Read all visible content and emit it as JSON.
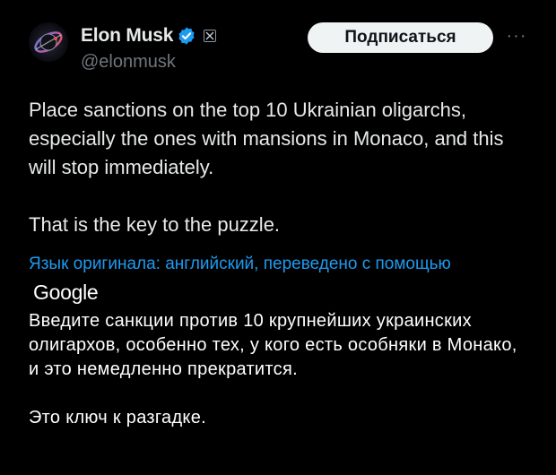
{
  "author": {
    "name": "Elon Musk",
    "handle": "@elonmusk",
    "verified_icon": "verified-badge-icon",
    "affiliation_icon": "x-logo-icon"
  },
  "actions": {
    "follow_label": "Подписаться",
    "more_label": "···"
  },
  "tweet": {
    "paragraph_1": "Place sanctions on the top 10 Ukrainian oligarchs, especially the ones with mansions in Monaco, and this will stop immediately.",
    "paragraph_2": "That is the key to the puzzle."
  },
  "translation": {
    "notice": "Язык оригинала: английский, переведено с помощью",
    "provider": "Google",
    "paragraph_1": "Введите санкции против 10 крупнейших украинских олигархов, особенно тех, у кого есть особняки в Монако, и это немедленно прекратится.",
    "paragraph_2": "Это ключ к разгадке."
  },
  "colors": {
    "background": "#000000",
    "text": "#e7e9ea",
    "muted": "#71767b",
    "link": "#1d9bf0",
    "verified": "#1d9bf0",
    "button_bg": "#eff3f4"
  }
}
